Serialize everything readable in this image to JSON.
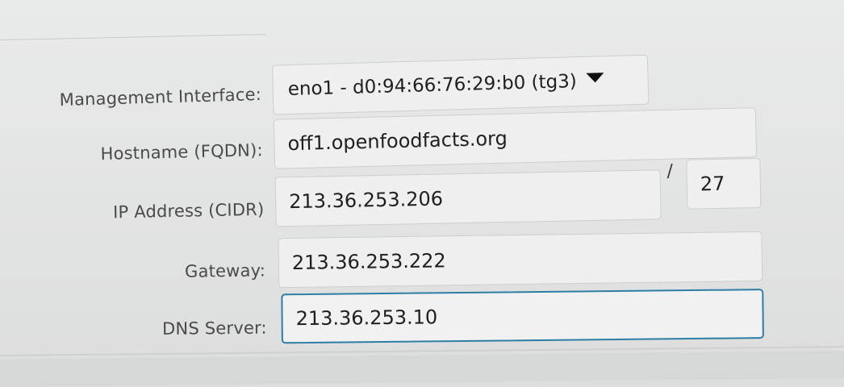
{
  "form": {
    "management_interface": {
      "label": "Management Interface:",
      "value": "eno1 - d0:94:66:76:29:b0 (tg3)"
    },
    "hostname": {
      "label": "Hostname (FQDN):",
      "value": "off1.openfoodfacts.org"
    },
    "ip_address": {
      "label": "IP Address (CIDR)",
      "value": "213.36.253.206",
      "separator": "/",
      "prefix": "27"
    },
    "gateway": {
      "label": "Gateway:",
      "value": "213.36.253.222"
    },
    "dns_server": {
      "label": "DNS Server:",
      "value": "213.36.253.10"
    }
  },
  "icons": {
    "dropdown": "chevron-down-icon"
  }
}
